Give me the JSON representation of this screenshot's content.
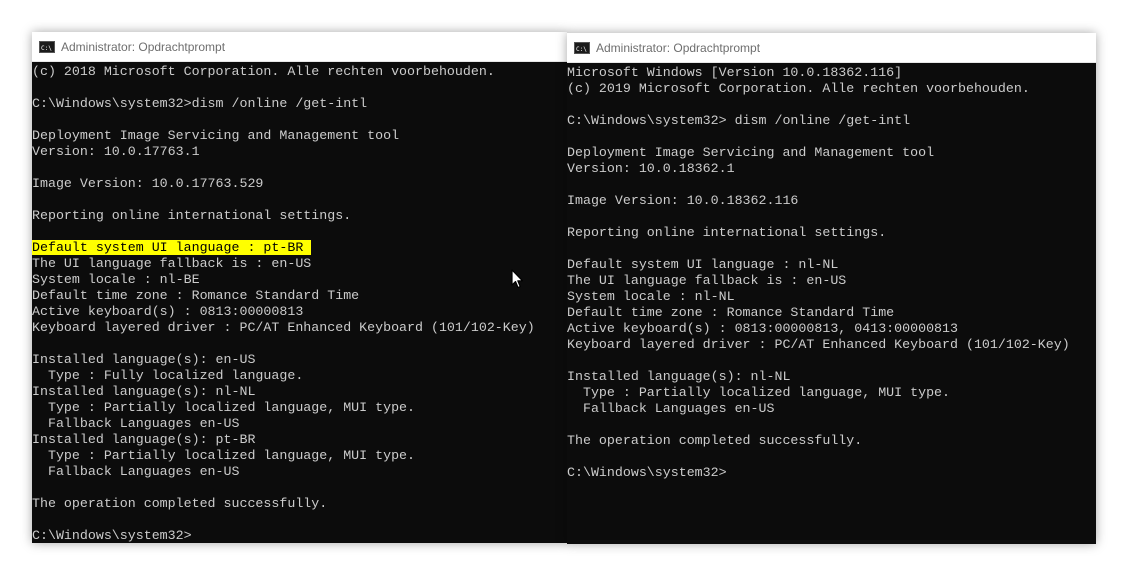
{
  "left_window": {
    "title": "Administrator: Opdrachtprompt",
    "lines": [
      "(c) 2018 Microsoft Corporation. Alle rechten voorbehouden.",
      "",
      "C:\\Windows\\system32>dism /online /get-intl",
      "",
      "Deployment Image Servicing and Management tool",
      "Version: 10.0.17763.1",
      "",
      "Image Version: 10.0.17763.529",
      "",
      "Reporting online international settings.",
      "",
      "Default system UI language : pt-BR",
      "The UI language fallback is : en-US",
      "System locale : nl-BE",
      "Default time zone : Romance Standard Time",
      "Active keyboard(s) : 0813:00000813",
      "Keyboard layered driver : PC/AT Enhanced Keyboard (101/102-Key)",
      "",
      "Installed language(s): en-US",
      "  Type : Fully localized language.",
      "Installed language(s): nl-NL",
      "  Type : Partially localized language, MUI type.",
      "  Fallback Languages en-US",
      "Installed language(s): pt-BR",
      "  Type : Partially localized language, MUI type.",
      "  Fallback Languages en-US",
      "",
      "The operation completed successfully.",
      "",
      "C:\\Windows\\system32>"
    ],
    "highlighted_line": "Default system UI language : pt-BR"
  },
  "right_window": {
    "title": "Administrator: Opdrachtprompt",
    "lines": [
      "Microsoft Windows [Version 10.0.18362.116]",
      "(c) 2019 Microsoft Corporation. Alle rechten voorbehouden.",
      "",
      "C:\\Windows\\system32> dism /online /get-intl",
      "",
      "Deployment Image Servicing and Management tool",
      "Version: 10.0.18362.1",
      "",
      "Image Version: 10.0.18362.116",
      "",
      "Reporting online international settings.",
      "",
      "Default system UI language : nl-NL",
      "The UI language fallback is : en-US",
      "System locale : nl-NL",
      "Default time zone : Romance Standard Time",
      "Active keyboard(s) : 0813:00000813, 0413:00000813",
      "Keyboard layered driver : PC/AT Enhanced Keyboard (101/102-Key)",
      "",
      "Installed language(s): nl-NL",
      "  Type : Partially localized language, MUI type.",
      "  Fallback Languages en-US",
      "",
      "The operation completed successfully.",
      "",
      "C:\\Windows\\system32>"
    ]
  },
  "colors": {
    "console_bg": "#0c0c0c",
    "console_text": "#cccccc",
    "highlight": "#ffff00",
    "title_text": "#6e6e6e"
  },
  "icons": {
    "app_icon": "cmd-icon",
    "pointer": "mouse-cursor-icon"
  }
}
